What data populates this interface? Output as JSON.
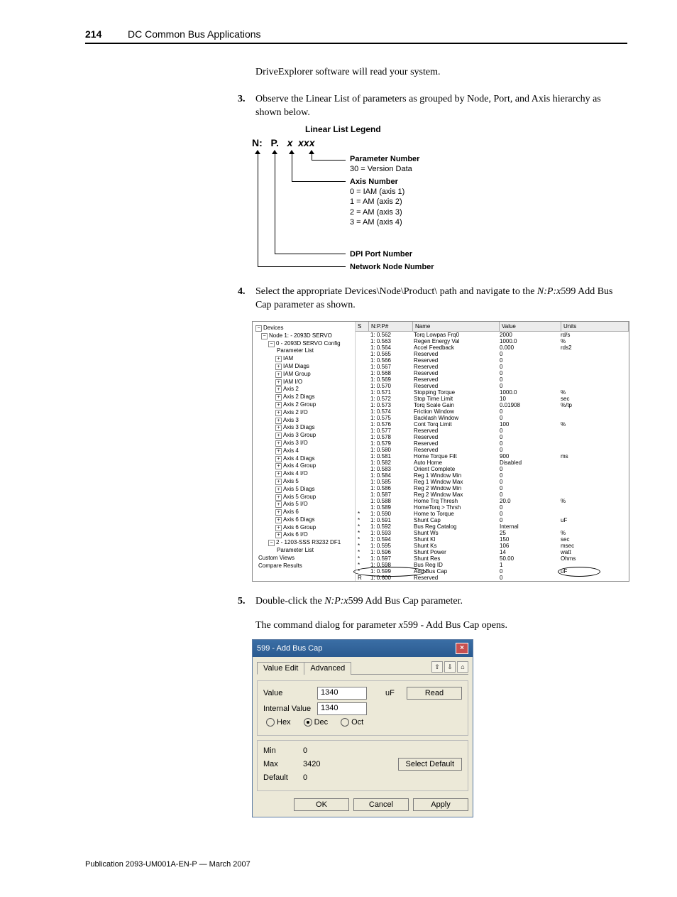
{
  "header": {
    "page_number": "214",
    "chapter": "DC Common Bus Applications"
  },
  "intro": "DriveExplorer software will read your system.",
  "step3": {
    "num": "3.",
    "text": "Observe the Linear List of parameters as grouped by Node, Port, and Axis hierarchy as shown below."
  },
  "legend": {
    "title": "Linear List Legend",
    "code_n": "N:",
    "code_p": "P.",
    "code_x": "x",
    "code_xxx": "xxx",
    "param_num_label": "Parameter Number",
    "param_num_sub": "30 = Version Data",
    "axis_num_label": "Axis Number",
    "axis_sub0": "0 = IAM (axis 1)",
    "axis_sub1": "1 = AM (axis 2)",
    "axis_sub2": "2 = AM (axis 3)",
    "axis_sub3": "3 = AM (axis 4)",
    "dpi_label": "DPI Port Number",
    "node_label": "Network Node Number"
  },
  "step4": {
    "num": "4.",
    "text_a": "Select the appropriate Devices\\Node\\Product\\ path and navigate to the ",
    "text_b": "N:P:x",
    "text_c": "599 Add Bus Cap parameter as shown."
  },
  "tree": {
    "root": "Devices",
    "items": [
      "Node 1: - 2093D SERVO",
      "0 - 2093D SERVO Config",
      "Parameter List",
      "IAM",
      "IAM Diags",
      "IAM Group",
      "IAM I/O",
      "Axis 2",
      "Axis 2 Diags",
      "Axis 2 Group",
      "Axis 2 I/O",
      "Axis 3",
      "Axis 3 Diags",
      "Axis 3 Group",
      "Axis 3 I/O",
      "Axis 4",
      "Axis 4 Diags",
      "Axis 4 Group",
      "Axis 4 I/O",
      "Axis 5",
      "Axis 5 Diags",
      "Axis 5 Group",
      "Axis 5 I/O",
      "Axis 6",
      "Axis 6 Diags",
      "Axis 6 Group",
      "Axis 6 I/O",
      "2 - 1203-SSS R3232 DF1",
      "Parameter List",
      "Custom Views",
      "Compare Results"
    ]
  },
  "list": {
    "headers": {
      "s": "S",
      "npp": "N:P.P#",
      "name": "Name",
      "value": "Value",
      "units": "Units"
    },
    "rows": [
      {
        "s": "",
        "npp": "1: 0.562",
        "name": "Torq Lowpas Frq0",
        "value": "2000",
        "units": "rd/s"
      },
      {
        "s": "",
        "npp": "1: 0.563",
        "name": "Regen Energy Val",
        "value": "1000.0",
        "units": "%"
      },
      {
        "s": "",
        "npp": "1: 0.564",
        "name": "Accel Feedback",
        "value": "0.000",
        "units": "rds2"
      },
      {
        "s": "",
        "npp": "1: 0.565",
        "name": "Reserved",
        "value": "0",
        "units": ""
      },
      {
        "s": "",
        "npp": "1: 0.566",
        "name": "Reserved",
        "value": "0",
        "units": ""
      },
      {
        "s": "",
        "npp": "1: 0.567",
        "name": "Reserved",
        "value": "0",
        "units": ""
      },
      {
        "s": "",
        "npp": "1: 0.568",
        "name": "Reserved",
        "value": "0",
        "units": ""
      },
      {
        "s": "",
        "npp": "1: 0.569",
        "name": "Reserved",
        "value": "0",
        "units": ""
      },
      {
        "s": "",
        "npp": "1: 0.570",
        "name": "Reserved",
        "value": "0",
        "units": ""
      },
      {
        "s": "",
        "npp": "1: 0.571",
        "name": "Stopping Torque",
        "value": "1000.0",
        "units": "%"
      },
      {
        "s": "",
        "npp": "1: 0.572",
        "name": "Stop Time Limit",
        "value": "10",
        "units": "sec"
      },
      {
        "s": "",
        "npp": "1: 0.573",
        "name": "Torq Scale Gain",
        "value": "0.01908",
        "units": "%/tp"
      },
      {
        "s": "",
        "npp": "1: 0.574",
        "name": "Friction Window",
        "value": "0",
        "units": ""
      },
      {
        "s": "",
        "npp": "1: 0.575",
        "name": "Backlash Window",
        "value": "0",
        "units": ""
      },
      {
        "s": "",
        "npp": "1: 0.576",
        "name": "Cont Torq Limit",
        "value": "100",
        "units": "%"
      },
      {
        "s": "",
        "npp": "1: 0.577",
        "name": "Reserved",
        "value": "0",
        "units": ""
      },
      {
        "s": "",
        "npp": "1: 0.578",
        "name": "Reserved",
        "value": "0",
        "units": ""
      },
      {
        "s": "",
        "npp": "1: 0.579",
        "name": "Reserved",
        "value": "0",
        "units": ""
      },
      {
        "s": "",
        "npp": "1: 0.580",
        "name": "Reserved",
        "value": "0",
        "units": ""
      },
      {
        "s": "",
        "npp": "1: 0.581",
        "name": "Home Torque Filt",
        "value": "900",
        "units": "ms"
      },
      {
        "s": "",
        "npp": "1: 0.582",
        "name": "Auto Home",
        "value": "Disabled",
        "units": ""
      },
      {
        "s": "",
        "npp": "1: 0.583",
        "name": "Orient Complete",
        "value": "0",
        "units": ""
      },
      {
        "s": "",
        "npp": "1: 0.584",
        "name": "Reg 1 Window Min",
        "value": "0",
        "units": ""
      },
      {
        "s": "",
        "npp": "1: 0.585",
        "name": "Reg 1 Window Max",
        "value": "0",
        "units": ""
      },
      {
        "s": "",
        "npp": "1: 0.586",
        "name": "Reg 2 Window Min",
        "value": "0",
        "units": ""
      },
      {
        "s": "",
        "npp": "1: 0.587",
        "name": "Reg 2 Window Max",
        "value": "0",
        "units": ""
      },
      {
        "s": "",
        "npp": "1: 0.588",
        "name": "Home Trq Thresh",
        "value": "20.0",
        "units": "%"
      },
      {
        "s": "",
        "npp": "1: 0.589",
        "name": "HomeTorq > Thrsh",
        "value": "0",
        "units": ""
      },
      {
        "s": "*",
        "npp": "1: 0.590",
        "name": "Home to Torque",
        "value": "0",
        "units": ""
      },
      {
        "s": "*",
        "npp": "1: 0.591",
        "name": "Shunt Cap",
        "value": "0",
        "units": "uF"
      },
      {
        "s": "*",
        "npp": "1: 0.592",
        "name": "Bus Reg Catalog",
        "value": "Internal",
        "units": ""
      },
      {
        "s": "*",
        "npp": "1: 0.593",
        "name": "Shunt Ws",
        "value": "25",
        "units": "%"
      },
      {
        "s": "*",
        "npp": "1: 0.594",
        "name": "Shunt Kl",
        "value": "150",
        "units": "sec"
      },
      {
        "s": "*",
        "npp": "1: 0.595",
        "name": "Shunt Ks",
        "value": "106",
        "units": "msec"
      },
      {
        "s": "*",
        "npp": "1: 0.596",
        "name": "Shunt Power",
        "value": "14",
        "units": "watt"
      },
      {
        "s": "*",
        "npp": "1: 0.597",
        "name": "Shunt Res",
        "value": "50.00",
        "units": "Ohms"
      },
      {
        "s": "*",
        "npp": "1: 0.598",
        "name": "Bus Reg ID",
        "value": "1",
        "units": ""
      },
      {
        "s": "*",
        "npp": "1: 0.599",
        "name": "Add Bus Cap",
        "value": "0",
        "units": "uF"
      },
      {
        "s": "R",
        "npp": "1: 0.600",
        "name": "Reserved",
        "value": "0",
        "units": ""
      }
    ]
  },
  "step5": {
    "num": "5.",
    "text_a": "Double-click the ",
    "text_b": "N:P:x",
    "text_c": "599 Add Bus Cap parameter."
  },
  "step5_follow_a": "The command dialog for parameter ",
  "step5_follow_b": "x",
  "step5_follow_c": "599 - Add Bus Cap opens.",
  "dialog": {
    "title": "599 -  Add Bus Cap",
    "tab1": "Value Edit",
    "tab2": "Advanced",
    "value_label": "Value",
    "value": "1340",
    "unit": "uF",
    "internal_label": "Internal Value",
    "internal": "1340",
    "hex": "Hex",
    "dec": "Dec",
    "oct": "Oct",
    "min_label": "Min",
    "min": "0",
    "max_label": "Max",
    "max": "3420",
    "default_label": "Default",
    "default": "0",
    "read": "Read",
    "select_default": "Select Default",
    "ok": "OK",
    "cancel": "Cancel",
    "apply": "Apply"
  },
  "footer": "Publication 2093-UM001A-EN-P — March 2007"
}
